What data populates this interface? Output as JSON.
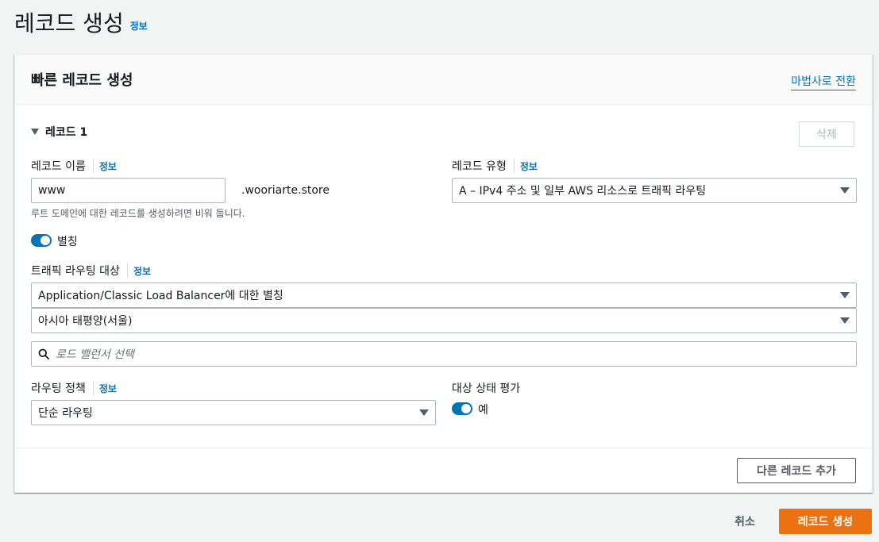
{
  "page": {
    "title": "레코드 생성",
    "info": "정보"
  },
  "card": {
    "title": "빠른 레코드 생성",
    "wizard_link": "마법사로 전환",
    "record_heading": "레코드 1",
    "delete_label": "삭제",
    "record_name": {
      "label": "레코드 이름",
      "info": "정보",
      "value": "www",
      "suffix": ".wooriarte.store",
      "hint": "루트 도메인에 대한 레코드를 생성하려면 비워 둡니다."
    },
    "record_type": {
      "label": "레코드 유형",
      "info": "정보",
      "value": "A – IPv4 주소 및 일부 AWS 리소스로 트래픽 라우팅"
    },
    "alias": {
      "label": "별칭",
      "enabled": true
    },
    "traffic_target": {
      "label": "트래픽 라우팅 대상",
      "info": "정보",
      "endpoint": "Application/Classic Load Balancer에 대한 별칭",
      "region": "아시아 태평양(서울)",
      "search_placeholder": "로드 밸런서 선택"
    },
    "routing_policy": {
      "label": "라우팅 정책",
      "info": "정보",
      "value": "단순 라우팅"
    },
    "health_eval": {
      "label": "대상 상태 평가",
      "toggle_label": "예",
      "enabled": true
    },
    "add_record_label": "다른 레코드 추가"
  },
  "footer": {
    "cancel_label": "취소",
    "create_label": "레코드 생성"
  },
  "colors": {
    "accent": "#0073bb",
    "primary_button": "#ec7211"
  }
}
